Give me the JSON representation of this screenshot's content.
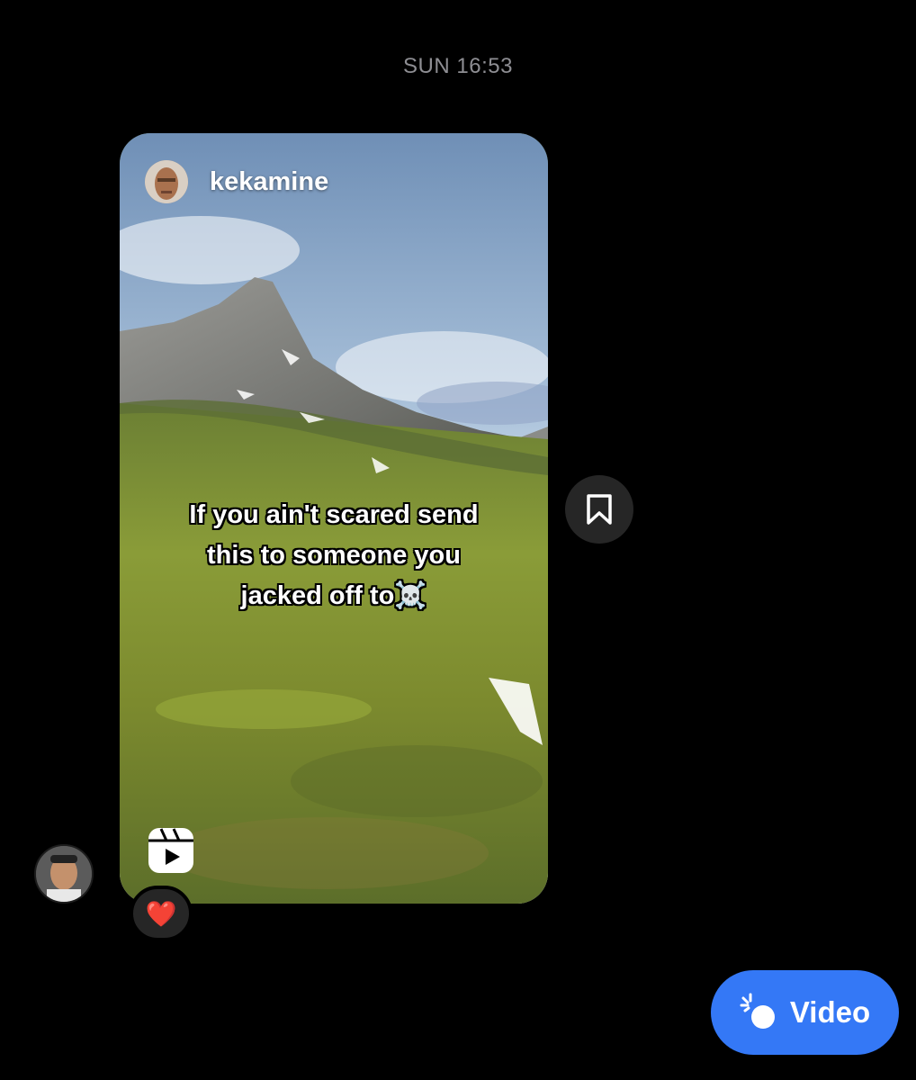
{
  "thread": {
    "timestamp": "SUN 16:53"
  },
  "shared_reel": {
    "author": "kekamine",
    "caption_lines": [
      "If you ain't scared send",
      "this to someone you",
      "jacked off to☠️"
    ],
    "reaction_emoji": "❤️"
  },
  "icons": {
    "save": "bookmark-icon",
    "reel": "reels-icon",
    "video": "video-tap-icon"
  },
  "composer": {
    "video_label": "Video"
  },
  "colors": {
    "background": "#000000",
    "timestamp": "#8e8e93",
    "button_dark": "#262626",
    "accent_blue": "#3478f6",
    "heart": "#ff2b45"
  }
}
